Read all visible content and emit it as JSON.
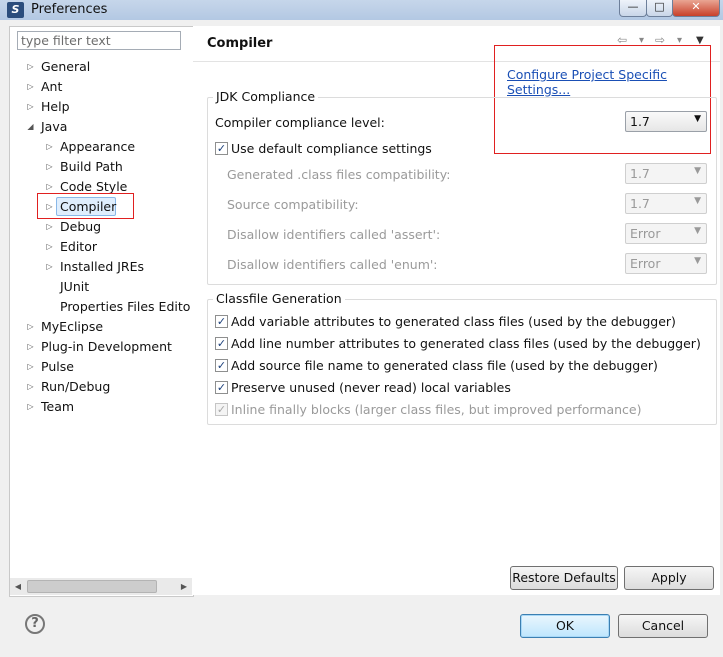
{
  "window": {
    "title": "Preferences",
    "min_glyph": "—",
    "max_glyph": "□",
    "close_glyph": "✕"
  },
  "filter": {
    "placeholder": "type filter text"
  },
  "tree": [
    {
      "label": "General",
      "arrow": "▷"
    },
    {
      "label": "Ant",
      "arrow": "▷"
    },
    {
      "label": "Help",
      "arrow": "▷"
    },
    {
      "label": "Java",
      "arrow": "◢"
    },
    {
      "label": "Appearance",
      "arrow": "▷"
    },
    {
      "label": "Build Path",
      "arrow": "▷"
    },
    {
      "label": "Code Style",
      "arrow": "▷"
    },
    {
      "label": "Compiler",
      "arrow": "▷"
    },
    {
      "label": "Debug",
      "arrow": "▷"
    },
    {
      "label": "Editor",
      "arrow": "▷"
    },
    {
      "label": "Installed JREs",
      "arrow": "▷"
    },
    {
      "label": "JUnit",
      "arrow": ""
    },
    {
      "label": "Properties Files Edito",
      "arrow": ""
    },
    {
      "label": "MyEclipse",
      "arrow": "▷"
    },
    {
      "label": "Plug-in Development",
      "arrow": "▷"
    },
    {
      "label": "Pulse",
      "arrow": "▷"
    },
    {
      "label": "Run/Debug",
      "arrow": "▷"
    },
    {
      "label": "Team",
      "arrow": "▷"
    }
  ],
  "page": {
    "title": "Compiler",
    "config_link": "Configure Project Specific Settings...",
    "nav": {
      "back": "⇦",
      "forward": "⇨",
      "dropdown": "▾",
      "menu": "▼"
    }
  },
  "jdk": {
    "group_title": "JDK Compliance",
    "compliance_label": "Compiler compliance level:",
    "compliance_value": "1.7",
    "use_default_label": "Use default compliance settings",
    "use_default_checked": true,
    "generated_label": "Generated .class files compatibility:",
    "generated_value": "1.7",
    "source_label": "Source compatibility:",
    "source_value": "1.7",
    "assert_label": "Disallow identifiers called 'assert':",
    "assert_value": "Error",
    "enum_label": "Disallow identifiers called 'enum':",
    "enum_value": "Error"
  },
  "classfile": {
    "group_title": "Classfile Generation",
    "items": [
      {
        "label": "Add variable attributes to generated class files (used by the debugger)",
        "checked": true
      },
      {
        "label": "Add line number attributes to generated class files (used by the debugger)",
        "checked": true
      },
      {
        "label": "Add source file name to generated class file (used by the debugger)",
        "checked": true
      },
      {
        "label": "Preserve unused (never read) local variables",
        "checked": true
      },
      {
        "label": "Inline finally blocks (larger class files, but improved performance)",
        "checked": true,
        "disabled": true
      }
    ]
  },
  "buttons": {
    "restore": "Restore Defaults",
    "apply": "Apply",
    "ok": "OK",
    "cancel": "Cancel"
  },
  "icons": {
    "check": "✓",
    "combo_arrow": "▼",
    "help": "?",
    "scroll_left": "◀",
    "scroll_right": "▶"
  },
  "colors": {
    "selection_outline": "#e02020",
    "link": "#1a4fb5",
    "selection_bg": "#dfeefd"
  }
}
